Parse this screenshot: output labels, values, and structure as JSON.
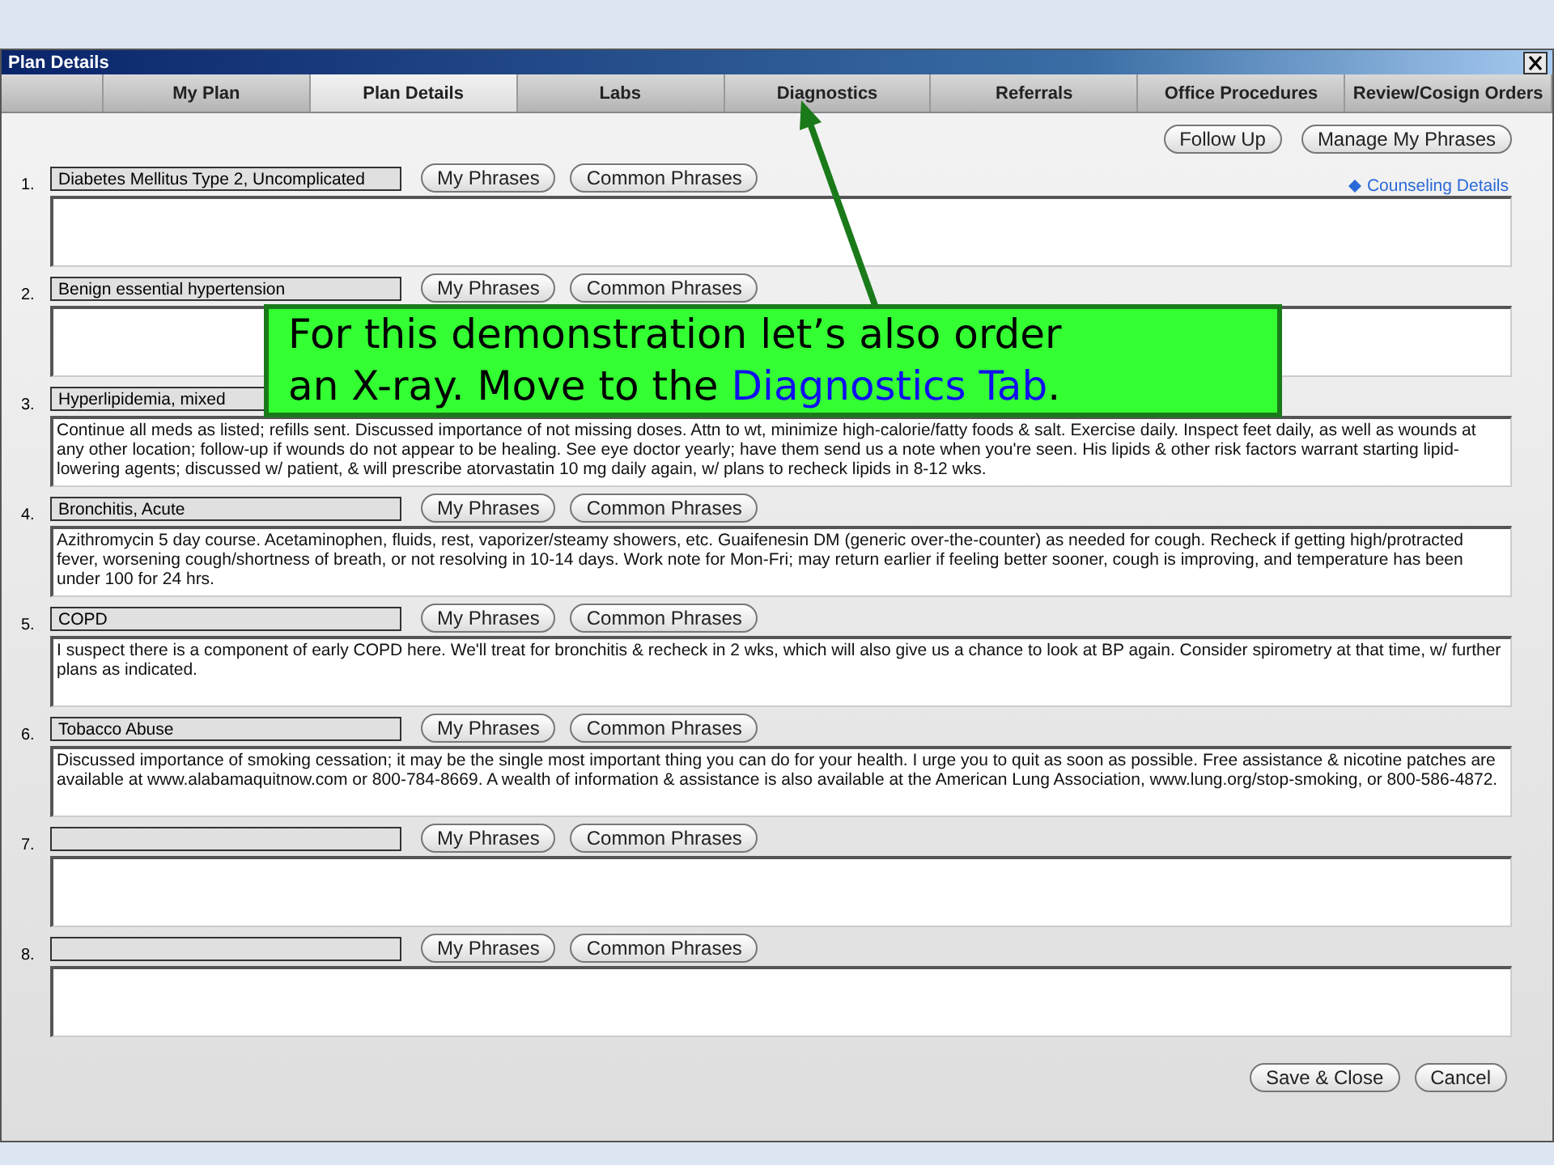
{
  "window": {
    "title": "Plan Details"
  },
  "tabs": [
    {
      "label": "My Plan",
      "selected": false
    },
    {
      "label": "Plan Details",
      "selected": true
    },
    {
      "label": "Labs",
      "selected": false
    },
    {
      "label": "Diagnostics",
      "selected": false
    },
    {
      "label": "Referrals",
      "selected": false
    },
    {
      "label": "Office Procedures",
      "selected": false
    },
    {
      "label": "Review/Cosign Orders",
      "selected": false
    }
  ],
  "top_buttons": [
    "Follow Up",
    "Manage My Phrases"
  ],
  "counseling_link": "Counseling Details",
  "problems": [
    {
      "number": "1.",
      "name": "Diabetes Mellitus Type 2, Uncomplicated",
      "buttons": [
        "My Phrases",
        "Common Phrases"
      ]
    },
    {
      "number": "2.",
      "name": "Benign essential hypertension",
      "buttons": [
        "My Phrases",
        "Common Phrases"
      ]
    },
    {
      "number": "3.",
      "name": "Hyperlipidemia, mixed",
      "note": "Continue all meds as listed; refills sent.  Discussed importance of not missing doses.  Attn to wt, minimize high-calorie/fatty foods & salt.  Exercise daily.  Inspect feet daily, as well as wounds at any other location; follow-up if wounds do not appear to be healing.  See eye doctor yearly; have them send us a note when you're seen.  His lipids & other risk factors warrant starting lipid-lowering agents; discussed w/ patient, & will prescribe atorvastatin 10 mg daily again, w/ plans to recheck lipids in 8-12 wks."
    },
    {
      "number": "4.",
      "name": "Bronchitis, Acute",
      "buttons": [
        "My Phrases",
        "Common Phrases"
      ],
      "note": "Azithromycin 5 day course.  Acetaminophen, fluids, rest, vaporizer/steamy showers, etc.  Guaifenesin DM (generic over-the-counter) as needed for cough.  Recheck if getting high/protracted fever, worsening cough/shortness of breath, or not resolving in 10-14 days.  Work note for Mon-Fri; may return earlier if feeling better sooner, cough is improving, and temperature has been under 100 for 24 hrs."
    },
    {
      "number": "5.",
      "name": "COPD",
      "buttons": [
        "My Phrases",
        "Common Phrases"
      ],
      "note": "I suspect there is a component of early COPD here.  We'll treat for bronchitis & recheck in 2 wks, which will also give us a chance to look at BP again.  Consider spirometry at that time, w/ further plans as indicated."
    },
    {
      "number": "6.",
      "name": "Tobacco Abuse",
      "buttons": [
        "My Phrases",
        "Common Phrases"
      ],
      "note": "Discussed importance of smoking cessation; it may be the single most important thing you can do for your health.  I urge you to quit as soon as possible.  Free assistance & nicotine patches are available at www.alabamaquitnow.com or 800-784-8669.  A wealth of information & assistance is also available at the American Lung Association, www.lung.org/stop-smoking, or 800-586-4872."
    },
    {
      "number": "7.",
      "buttons": [
        "My Phrases",
        "Common Phrases"
      ]
    },
    {
      "number": "8.",
      "buttons": [
        "My Phrases",
        "Common Phrases"
      ]
    }
  ],
  "footer_buttons": [
    "Save & Close",
    "Cancel"
  ],
  "callout": {
    "text": "For this demonstration let’s also order an X-ray.  Move to the ",
    "highlight": "Diagnostics Tab",
    "end": "."
  }
}
